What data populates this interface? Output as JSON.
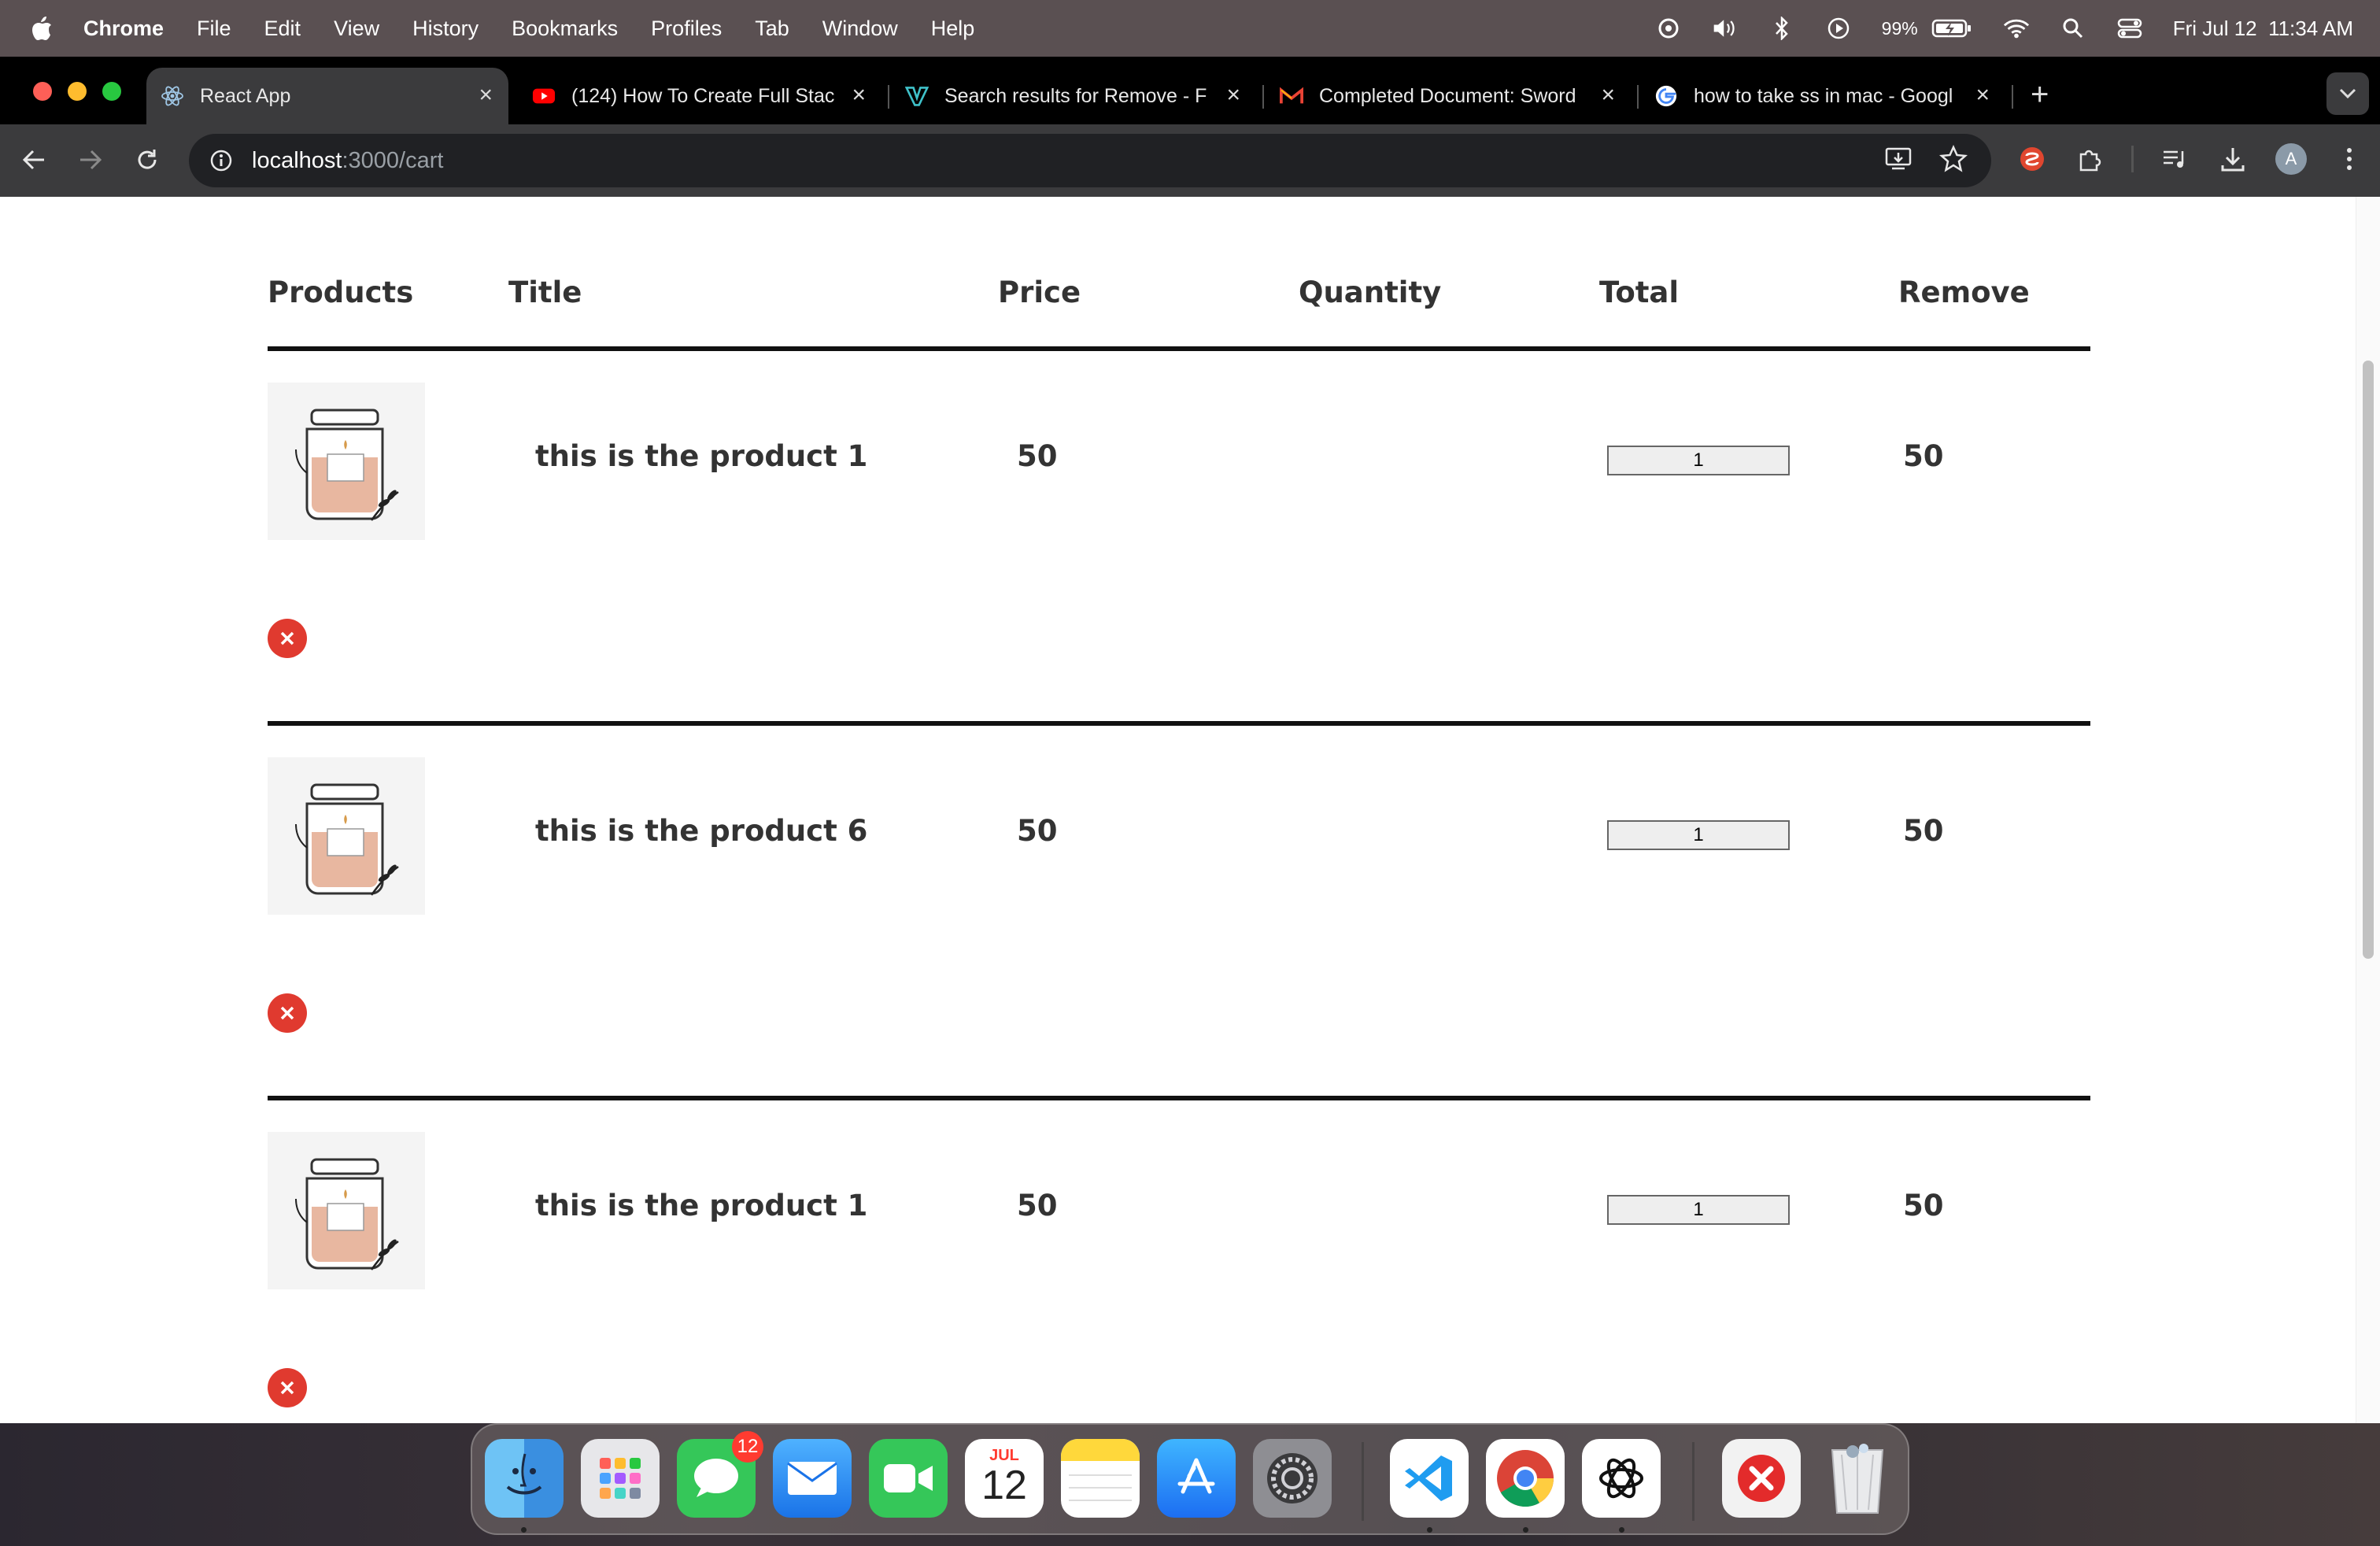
{
  "menubar": {
    "app_name": "Chrome",
    "menus": [
      "File",
      "Edit",
      "View",
      "History",
      "Bookmarks",
      "Profiles",
      "Tab",
      "Window",
      "Help"
    ],
    "battery": "99%",
    "datetime": "Fri Jul 12  11:34 AM"
  },
  "tabs": [
    {
      "title": "React App",
      "icon": "react-icon"
    },
    {
      "title": "(124) How To Create Full Stac",
      "icon": "youtube-icon"
    },
    {
      "title": "Search results for Remove - F",
      "icon": "vector-icon"
    },
    {
      "title": "Completed Document: Sword",
      "icon": "gmail-icon"
    },
    {
      "title": "how to take ss in mac - Googl",
      "icon": "google-icon"
    }
  ],
  "omnibox": {
    "host": "localhost",
    "path": ":3000/cart"
  },
  "profile": {
    "initial": "A"
  },
  "cart": {
    "headers": {
      "products": "Products",
      "title": "Title",
      "price": "Price",
      "quantity": "Quantity",
      "total": "Total",
      "remove": "Remove"
    },
    "rows": [
      {
        "title": "this is the product 1",
        "price": "50",
        "quantity": "1",
        "total": "50"
      },
      {
        "title": "this is the product 6",
        "price": "50",
        "quantity": "1",
        "total": "50"
      },
      {
        "title": "this is the product 1",
        "price": "50",
        "quantity": "1",
        "total": "50"
      }
    ]
  },
  "dock": {
    "messages_badge": "12",
    "calendar_month": "JUL",
    "calendar_day": "12"
  },
  "colors": {
    "remove_red": "#e03a2f",
    "menubar": "#5a5052",
    "toolbar": "#3b3b3d"
  }
}
